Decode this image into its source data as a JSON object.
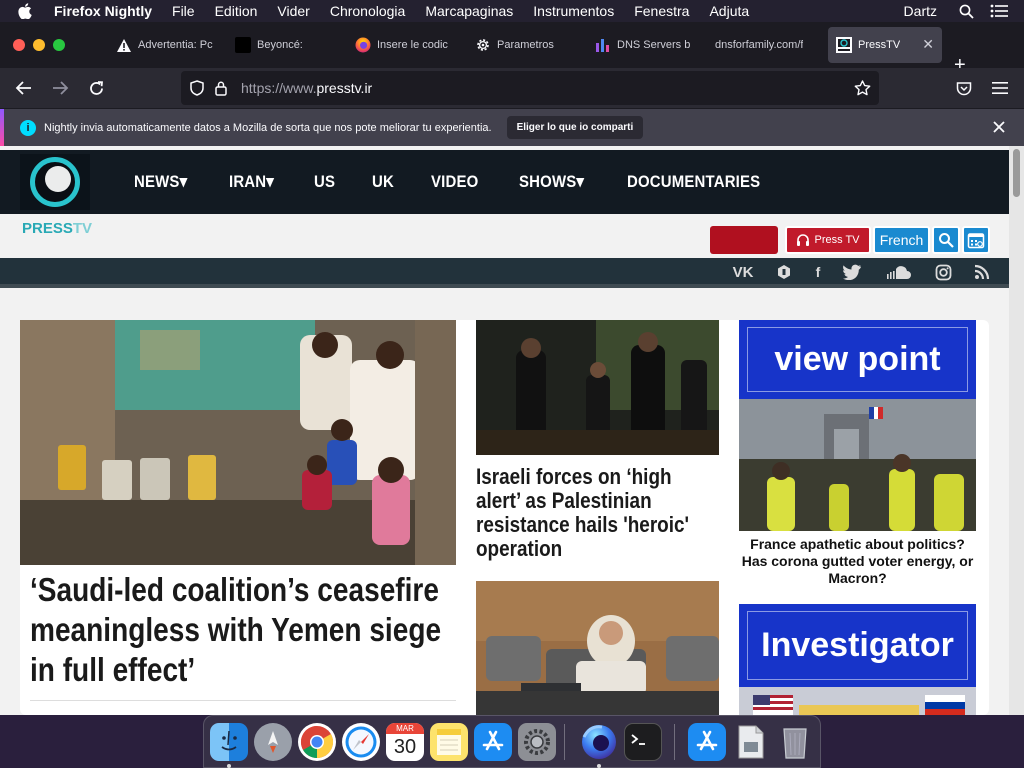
{
  "menubar": {
    "app_name": "Firefox Nightly",
    "items": [
      "File",
      "Edition",
      "Vider",
      "Chronologia",
      "Marcapaginas",
      "Instrumentos",
      "Fenestra",
      "Adjuta"
    ],
    "user": "Dartz"
  },
  "tabs": [
    {
      "label": "Advertentia: Pc",
      "icon": "warning-icon"
    },
    {
      "label": "Beyoncé:",
      "icon": "black-square-icon"
    },
    {
      "label": "Insere le codic",
      "icon": "firefox-icon"
    },
    {
      "label": "Parametros",
      "icon": "gear-icon"
    },
    {
      "label": "DNS Servers b",
      "icon": "chart-icon"
    },
    {
      "label": "dnsforfamily.com/f",
      "icon": "none"
    },
    {
      "label": "PressTV",
      "icon": "presstv-icon",
      "active": true
    }
  ],
  "url": {
    "prefix": "https://www.",
    "domain": "presstv.ir"
  },
  "notice": {
    "message": "Nightly invia automaticamente datos a Mozilla de sorta que nos pote meliorar tu experientia.",
    "button": "Eliger lo que io comparti"
  },
  "site": {
    "menu": [
      "NEWS",
      "IRAN",
      "US",
      "UK",
      "VIDEO",
      "SHOWS",
      "DOCUMENTARIES"
    ],
    "menu_dropdown": [
      true,
      true,
      false,
      false,
      false,
      true,
      false
    ],
    "brand_a": "PRESS",
    "brand_b": "TV",
    "press_tv_button": "Press TV",
    "lang_button": "French",
    "colors": {
      "nav": "#121a22",
      "teal": "#29c3cd",
      "red": "#b0101f",
      "blue": "#1a8ad0",
      "banner_blue": "#1734c9"
    }
  },
  "articles": {
    "lead_title": "‘Saudi-led coalition’s ceasefire meaningless with Yemen siege in full effect’",
    "second_title": "Israeli forces on ‘high alert’ as Palestinian resistance hails 'heroic' operation",
    "viewpoint_banner": "view point",
    "viewpoint_title": "France apathetic about politics? Has corona gutted voter energy, or Macron?",
    "investigator_banner": "Investigator"
  },
  "dock": {
    "apps": [
      "finder",
      "launchpad",
      "chrome",
      "safari",
      "calendar",
      "notes",
      "app-store",
      "system-preferences",
      "firefox-nightly",
      "terminal",
      "app-store-2",
      "preview",
      "trash"
    ],
    "calendar": {
      "month": "MAR",
      "day": "30"
    }
  }
}
